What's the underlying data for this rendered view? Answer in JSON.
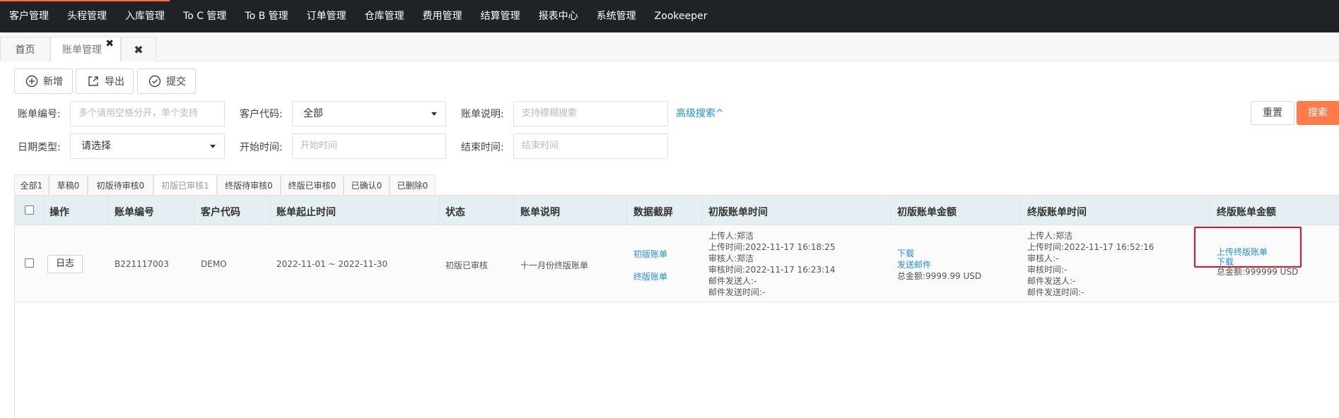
{
  "topnav": {
    "items": [
      "客户管理",
      "头程管理",
      "入库管理",
      "To C 管理",
      "To B 管理",
      "订单管理",
      "仓库管理",
      "费用管理",
      "结算管理",
      "报表中心",
      "系统管理",
      "Zookeeper"
    ]
  },
  "tabs": {
    "home": "首页",
    "current": "账单管理",
    "close_glyph": "✖",
    "close_all_glyph": "✖"
  },
  "toolbar": {
    "add": "新增",
    "export": "导出",
    "submit": "提交"
  },
  "filters": {
    "bill_no_label": "账单编号:",
    "bill_no_placeholder": "多个请用空格分开，单个支持",
    "customer_code_label": "客户代码:",
    "customer_code_value": "全部",
    "bill_desc_label": "账单说明:",
    "bill_desc_placeholder": "支持模糊搜索",
    "advanced_search": "高级搜索^",
    "date_type_label": "日期类型:",
    "date_type_value": "请选择",
    "start_time_label": "开始时间:",
    "start_time_placeholder": "开始时间",
    "end_time_label": "结束时间:",
    "end_time_placeholder": "结束时间",
    "reset": "重置",
    "search": "搜索"
  },
  "status_tabs": [
    "全部1",
    "草稿0",
    "初版待审核0",
    "初版已审核1",
    "终版待审核0",
    "终版已审核0",
    "已确认0",
    "已删除0"
  ],
  "table": {
    "headers": [
      "操作",
      "账单编号",
      "客户代码",
      "账单起止时间",
      "状态",
      "账单说明",
      "数据截屏",
      "初版账单时间",
      "初版账单金额",
      "终版账单时间",
      "终版账单金额"
    ],
    "row": {
      "log_button": "日志",
      "bill_no": "B221117003",
      "customer_code": "DEMO",
      "period": "2022-11-01 ~ 2022-11-30",
      "status": "初版已审核",
      "description": "十一月份终版账单",
      "screenshot_links": [
        "初版账单",
        "终版账单"
      ],
      "first_time_lines": [
        "上传人:郑洁",
        "上传时间:2022-11-17 16:18:25",
        "审核人:郑洁",
        "审核时间:2022-11-17 16:23:14",
        "邮件发送人:-",
        "邮件发送时间:-"
      ],
      "first_amount_links": [
        "下载",
        "发送邮件"
      ],
      "first_amount_total": "总金额:9999.99 USD",
      "final_time_lines": [
        "上传人:郑洁",
        "上传时间:2022-11-17 16:52:16",
        "审核人:-",
        "审核时间:-",
        "邮件发送人:-",
        "邮件发送时间:-"
      ],
      "final_amount_links": [
        "上传终版账单",
        "下载"
      ],
      "final_amount_total": "总金额:999999 USD"
    }
  },
  "colors": {
    "nav_bg": "#1f2327",
    "accent": "#ff7b4a",
    "link": "#1e90e0",
    "highlight": "#e8141b",
    "header_bg": "#e5eef3"
  }
}
